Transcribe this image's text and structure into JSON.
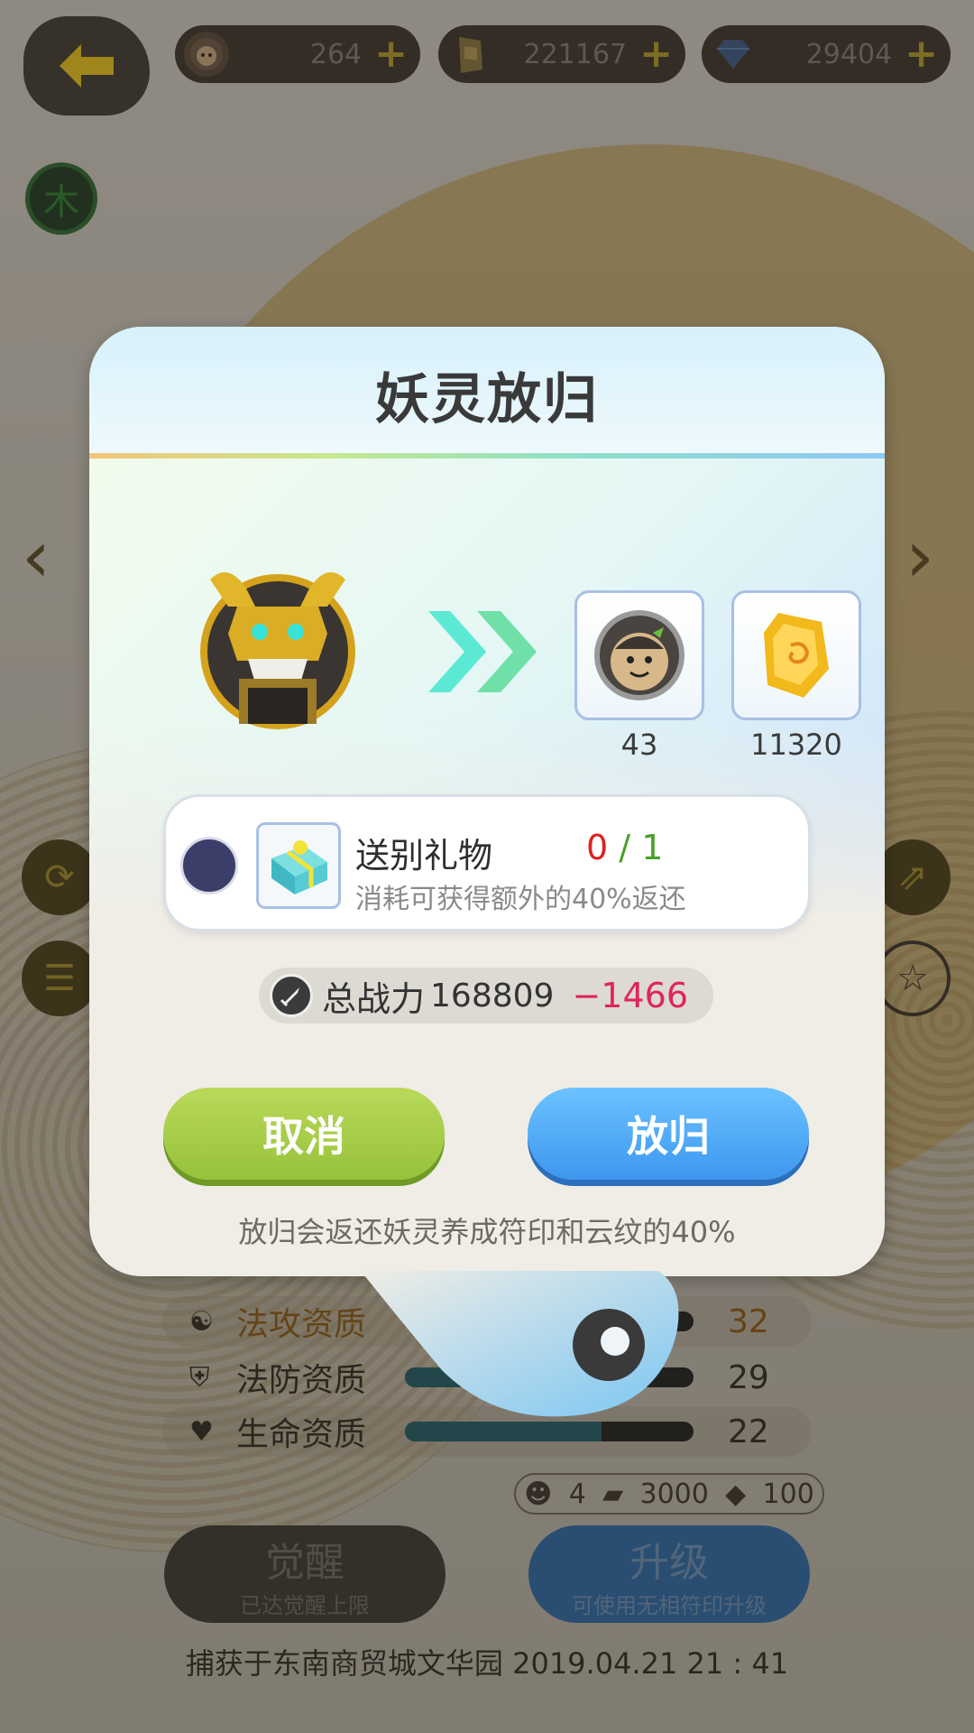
{
  "header": {
    "resources": [
      {
        "icon": "spirit-coin-icon",
        "value": "264"
      },
      {
        "icon": "talisman-icon",
        "value": "221167"
      },
      {
        "icon": "diamond-icon",
        "value": "29404"
      }
    ],
    "element_badge": "木"
  },
  "background": {
    "stats": [
      {
        "name": "法攻资质",
        "value": "32",
        "fill": 0.93
      },
      {
        "name": "法防资质",
        "value": "29",
        "fill": 0.84
      },
      {
        "name": "生命资质",
        "value": "22",
        "fill": 0.68
      }
    ],
    "upgrade_cost": {
      "spirit": "4",
      "talisman": "3000",
      "diamond": "100"
    },
    "awaken_button": {
      "label": "觉醒",
      "sub": "已达觉醒上限"
    },
    "upgrade_button": {
      "label": "升级",
      "sub": "可使用无相符印升级"
    },
    "capture_info": "捕获于东南商贸城文华园  2019.04.21   21 : 41"
  },
  "modal": {
    "title": "妖灵放归",
    "rewards": [
      {
        "icon": "spirit-coin-icon",
        "count": "43"
      },
      {
        "icon": "talisman-icon",
        "count": "11320"
      }
    ],
    "gift": {
      "name": "送别礼物",
      "current": "0",
      "separator": "/",
      "max": "1",
      "description": "消耗可获得额外的40%返还"
    },
    "power": {
      "label": "总战力",
      "value": "168809",
      "delta": "−1466"
    },
    "cancel_label": "取消",
    "confirm_label": "放归",
    "note": "放归会返还妖灵养成符印和云纹的40%"
  }
}
